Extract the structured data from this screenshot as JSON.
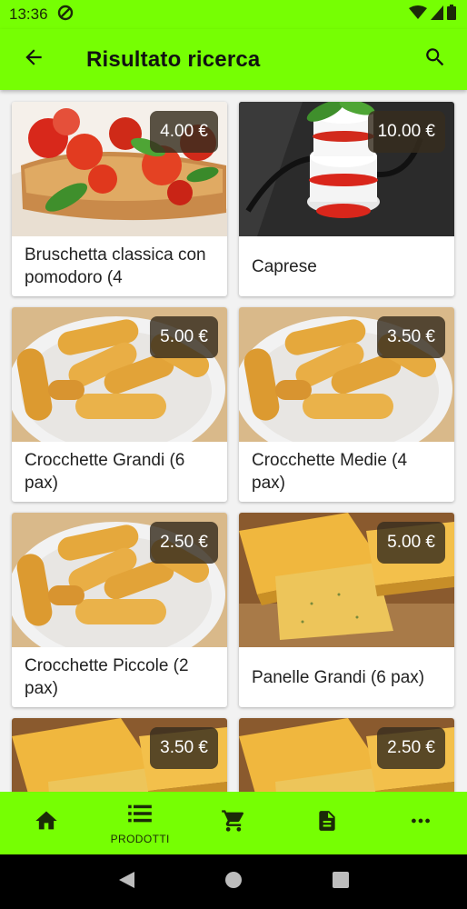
{
  "status_bar": {
    "time": "13:36"
  },
  "app_bar": {
    "title": "Risultato ricerca"
  },
  "products": [
    {
      "name": "Bruschetta classica con pomodoro (4",
      "price": "4.00 €",
      "image": "bruschetta"
    },
    {
      "name": "Caprese",
      "price": "10.00 €",
      "image": "caprese"
    },
    {
      "name": "Crocchette Grandi (6 pax)",
      "price": "5.00 €",
      "image": "crocchette"
    },
    {
      "name": "Crocchette Medie (4 pax)",
      "price": "3.50 €",
      "image": "crocchette"
    },
    {
      "name": "Crocchette Piccole (2 pax)",
      "price": "2.50 €",
      "image": "crocchette"
    },
    {
      "name": "Panelle Grandi (6 pax)",
      "price": "5.00 €",
      "image": "panelle"
    },
    {
      "name": "",
      "price": "3.50 €",
      "image": "panelle"
    },
    {
      "name": "",
      "price": "2.50 €",
      "image": "panelle"
    }
  ],
  "bottom_nav": {
    "items": [
      {
        "icon": "home-icon",
        "label": ""
      },
      {
        "icon": "list-icon",
        "label": "PRODOTTI"
      },
      {
        "icon": "cart-icon",
        "label": ""
      },
      {
        "icon": "document-icon",
        "label": ""
      },
      {
        "icon": "more-icon",
        "label": ""
      }
    ]
  },
  "colors": {
    "accent": "#76ff03",
    "price_badge": "#372d1e"
  }
}
